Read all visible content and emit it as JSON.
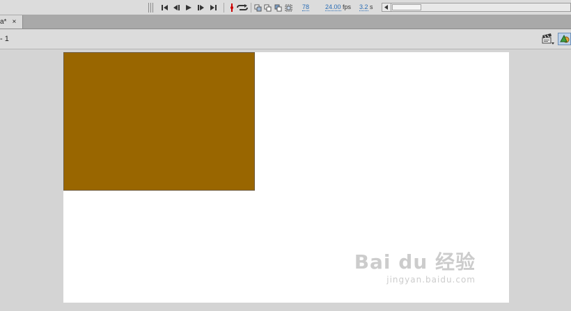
{
  "timeline": {
    "frame": "78",
    "fps_value": "24.00",
    "fps_unit": "fps",
    "time_value": "3.2",
    "time_unit": "s"
  },
  "document_tab": {
    "name": "a*",
    "close": "×"
  },
  "edit_bar": {
    "scene_label": "- 1"
  },
  "stage": {
    "background": "#ffffff",
    "rectangle_fill": "#996600"
  },
  "watermark": {
    "main": "Bai du 经验",
    "url": "jingyan.baidu.com"
  }
}
